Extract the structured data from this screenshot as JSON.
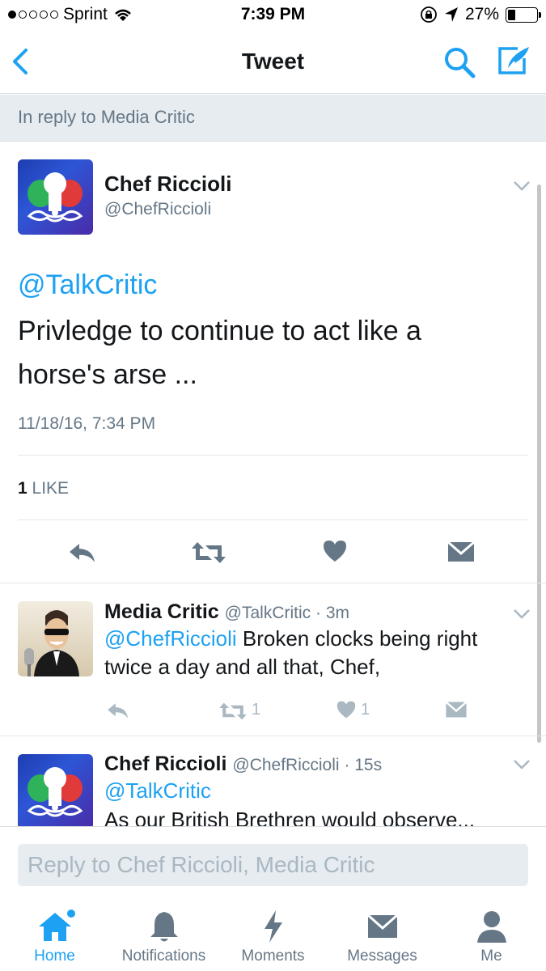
{
  "status_bar": {
    "carrier": "Sprint",
    "time": "7:39 PM",
    "battery": "27%",
    "battery_level": 0.27
  },
  "nav": {
    "title": "Tweet",
    "back_icon": "back-chevron-icon",
    "search_icon": "search-icon",
    "compose_icon": "compose-icon"
  },
  "reply_context": "In reply to Media Critic",
  "main_tweet": {
    "name": "Chef Riccioli",
    "handle": "@ChefRiccioli",
    "mention": "@TalkCritic",
    "text": "Privledge to continue to act like a horse's arse ...",
    "timestamp": "11/18/16, 7:34 PM",
    "likes_count": "1",
    "likes_label": "LIKE"
  },
  "replies": [
    {
      "name": "Media Critic",
      "handle": "@TalkCritic",
      "time": "3m",
      "mention": "@ChefRiccioli",
      "text": " Broken clocks being right twice a day and all that, Chef,",
      "retweets": "1",
      "likes": "1"
    },
    {
      "name": "Chef Riccioli",
      "handle": "@ChefRiccioli",
      "time": "15s",
      "mention": "@TalkCritic",
      "text": "As our British Brethren would observe..."
    }
  ],
  "reply_box": {
    "placeholder": "Reply to Chef Riccioli, Media Critic"
  },
  "tabs": [
    {
      "label": "Home",
      "icon": "home-icon"
    },
    {
      "label": "Notifications",
      "icon": "bell-icon"
    },
    {
      "label": "Moments",
      "icon": "lightning-icon"
    },
    {
      "label": "Messages",
      "icon": "envelope-icon"
    },
    {
      "label": "Me",
      "icon": "person-icon"
    }
  ],
  "colors": {
    "accent": "#1da1f2",
    "muted": "#657786",
    "light_icon": "#aab8c2",
    "dark_icon": "#657786"
  }
}
